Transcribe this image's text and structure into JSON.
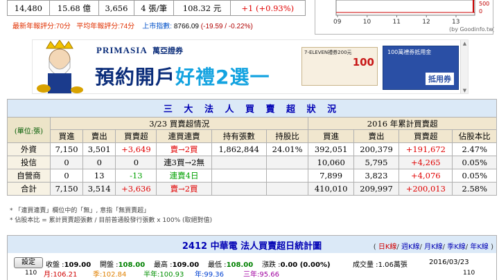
{
  "stats": {
    "volume": "14,480",
    "turnover": "15.68 億",
    "trades": "3,656",
    "avg_per_trade": "4 張/筆",
    "vol_price": "108.32 元",
    "change": "+1 (+0.93%)"
  },
  "ratings": {
    "latest_label": "最新年報評分:",
    "latest_value": "70分",
    "avg_label": "平均年報評分:",
    "avg_value": "74分",
    "index_label": "上市指數:",
    "index_value": "8766.09",
    "index_change": "(-19.59 / -0.22%)"
  },
  "mini_chart": {
    "x_ticks": [
      "09",
      "10",
      "11",
      "12",
      "13"
    ],
    "y_ticks": [
      "500",
      "0"
    ],
    "credit": "(by Goodinfo.tw)"
  },
  "ad": {
    "brand": "PRIMASIA",
    "brand_cn": "萬亞證券",
    "headline_a": "預約開戶",
    "headline_b": "好禮2選一",
    "coupon1_title": "7-ELEVEN禮券200元",
    "coupon1_value": "100",
    "coupon2_title": "100萬禮券抵用金",
    "coupon2_sub": "抵用券"
  },
  "institutional": {
    "title": "三 大 法 人 買 賣 超 狀 況",
    "unit": "(單位:張)",
    "period_label": "3/23 買賣超情況",
    "ytd_label": "2016 年累計買賣超",
    "columns": [
      "買進",
      "賣出",
      "買賣超",
      "連買連賣",
      "持有張數",
      "持股比",
      "買進",
      "賣出",
      "買賣超",
      "佔股本比"
    ],
    "rows": [
      {
        "label": "外資",
        "cells": [
          "7,150",
          "3,501",
          "+3,649",
          "賣→2買",
          "1,862,844",
          "24.01%",
          "392,051",
          "200,379",
          "+191,672",
          "2.47%"
        ]
      },
      {
        "label": "投信",
        "cells": [
          "0",
          "0",
          "0",
          "連3買→2無",
          "",
          "",
          "10,060",
          "5,795",
          "+4,265",
          "0.05%"
        ]
      },
      {
        "label": "自營商",
        "cells": [
          "0",
          "13",
          "-13",
          "連賣4日",
          "",
          "",
          "7,899",
          "3,823",
          "+4,076",
          "0.05%"
        ]
      },
      {
        "label": "合計",
        "cells": [
          "7,150",
          "3,514",
          "+3,636",
          "賣→2買",
          "",
          "",
          "410,010",
          "209,997",
          "+200,013",
          "2.58%"
        ]
      }
    ],
    "notes": [
      "* 「連買連賣」欄位中的「無」, 意指「無買賣超」",
      "* 佔股本比 = 累計買賣超張數 / 目前普通股發行張數 x 100% (取絕對值)"
    ]
  },
  "daily": {
    "title": "2412 中華電 法人買賣超日統計圖",
    "tabs": [
      "日K線",
      "週K線",
      "月K線",
      "季K線",
      "年K線"
    ],
    "settings_label": "設定",
    "close_label": "收盤 :",
    "close_value": "109.00",
    "open_label": "開盤 :",
    "open_value": "108.00",
    "high_label": "最高 :",
    "high_value": "109.00",
    "low_label": "最低 :",
    "low_value": "108.00",
    "change_label": "漲跌 :",
    "change_value": "0.00 (0.00%)",
    "volume_label": "成交量 :",
    "volume_value": "1.06萬張",
    "date": "2016/03/23",
    "ma": [
      "月:106.21",
      "季:102.84",
      "半年:100.93",
      "年:99.36",
      "三年:95.66"
    ],
    "axis_value": "110"
  },
  "colors": {
    "up": "#e00000",
    "down": "#00a000",
    "title_blue": "#0000b4",
    "header_bg": "#dbe9f7",
    "col_head_bg": "#f1e7cf"
  }
}
